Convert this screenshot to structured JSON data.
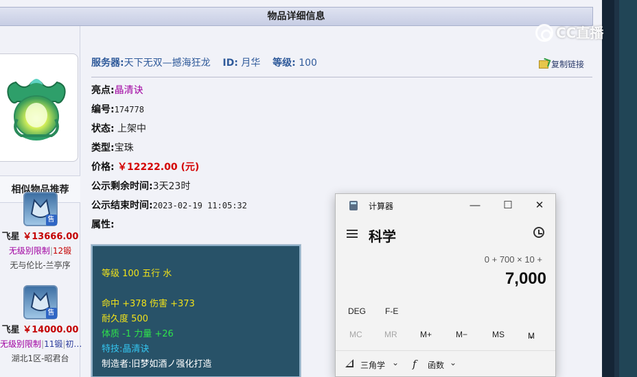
{
  "page": {
    "title": "物品详细信息"
  },
  "item": {
    "server_label": "服务器:",
    "server_value": "天下无双—撼海狂龙",
    "id_label": "ID:",
    "id_value": "月华",
    "level_label": "等级:",
    "level_value": "100",
    "copy_link": "复制链接"
  },
  "details": [
    {
      "label": "亮点:",
      "value": "晶清诀"
    },
    {
      "label": "编号:",
      "value": "174778"
    },
    {
      "label": "状态:",
      "value": " 上架中"
    },
    {
      "label": "类型:",
      "value": "宝珠"
    },
    {
      "label": "价格:",
      "value": "￥12222.00 (元)"
    },
    {
      "label": "公示剩余时间:",
      "value": "3天23时"
    },
    {
      "label": "公示结束时间:",
      "value": "2023-02-19 11:05:32"
    },
    {
      "label": "属性:",
      "value": ""
    }
  ],
  "attributes": {
    "line1": "等级 100 五行 水",
    "line2": "命中 +378 伤害 +373",
    "line3": "耐久度 500",
    "line4": "体质 -1 力量 +26",
    "line5": "特技:晶清诀",
    "line6": "制造者:旧梦如酒ノ强化打造"
  },
  "recommend": {
    "title": "相似物品推荐",
    "items": [
      {
        "badge": "售",
        "name_suffix": "飞星",
        "price": "￥13666.00",
        "limit": "无级别限制",
        "forge": "12锻",
        "extra": "",
        "server": "无与伦比-兰亭序"
      },
      {
        "badge": "售",
        "name_suffix": "飞星",
        "price": "￥14000.00",
        "limit": "无级别限制",
        "forge": "11锻",
        "extra": "初…",
        "server": "湖北1区-昭君台"
      }
    ]
  },
  "calculator": {
    "title": "计算器",
    "mode": "科学",
    "expression": "0 + 700 × 10 +",
    "result": "7,000",
    "fn_buttons": [
      "DEG",
      "F-E"
    ],
    "mem_buttons": [
      "MC",
      "MR",
      "M+",
      "M−",
      "MS",
      "M"
    ],
    "trig_label": "三角学",
    "func_label": "函数"
  },
  "watermark": {
    "text": "CC直播"
  },
  "colors": {
    "price_red": "#d40000",
    "highlight_purple": "#a000a0",
    "attr_bg": "#285268",
    "attr_yellow": "#f1e21a",
    "attr_green": "#2fe34b",
    "attr_blue": "#34c5ef"
  }
}
